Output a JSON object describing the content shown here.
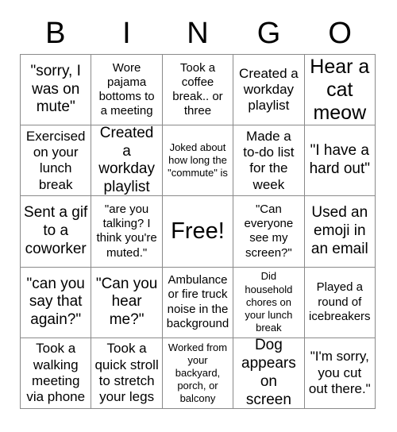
{
  "card": {
    "title": "BINGO",
    "header_letters": [
      "B",
      "I",
      "N",
      "G",
      "O"
    ],
    "rows": 5,
    "columns": 5,
    "free_space_label": "Free!",
    "free_space_position": {
      "row": 3,
      "column": 3
    },
    "colors": {
      "background": "#ffffff",
      "cell_background": "#ffffff",
      "grid_line": "#8a8a8a",
      "text": "#000000"
    }
  },
  "cells": [
    {
      "id": "r1c1",
      "text": "\"sorry, I was on mute\"",
      "size": "xl"
    },
    {
      "id": "r1c2",
      "text": "Wore pajama bottoms to a meeting",
      "size": "md"
    },
    {
      "id": "r1c3",
      "text": "Took a coffee break.. or three",
      "size": "md"
    },
    {
      "id": "r1c4",
      "text": "Created a workday playlist",
      "size": "lg"
    },
    {
      "id": "r1c5",
      "text": "Hear a cat meow",
      "size": "xxl"
    },
    {
      "id": "r2c1",
      "text": "Exercised on your lunch break",
      "size": "lg"
    },
    {
      "id": "r2c2",
      "text": "Created a workday playlist",
      "size": "xl"
    },
    {
      "id": "r2c3",
      "text": "Joked about how long the \"commute\" is",
      "size": "sm"
    },
    {
      "id": "r2c4",
      "text": "Made a to-do list for the week",
      "size": "lg"
    },
    {
      "id": "r2c5",
      "text": "\"I have a hard out\"",
      "size": "xl"
    },
    {
      "id": "r3c1",
      "text": "Sent a gif to a coworker",
      "size": "xl"
    },
    {
      "id": "r3c2",
      "text": "\"are you talking? I think you're muted.\"",
      "size": "md"
    },
    {
      "id": "r3c3",
      "text": "Free!",
      "size": "free"
    },
    {
      "id": "r3c4",
      "text": "\"Can everyone see my screen?\"",
      "size": "md"
    },
    {
      "id": "r3c5",
      "text": "Used an emoji in an email",
      "size": "xl"
    },
    {
      "id": "r4c1",
      "text": "\"can you say that again?\"",
      "size": "xl"
    },
    {
      "id": "r4c2",
      "text": "\"Can you hear me?\"",
      "size": "xl"
    },
    {
      "id": "r4c3",
      "text": "Ambulance or fire truck noise in the background",
      "size": "md"
    },
    {
      "id": "r4c4",
      "text": "Did household chores on your lunch break",
      "size": "sm"
    },
    {
      "id": "r4c5",
      "text": "Played a round of icebreakers",
      "size": "md"
    },
    {
      "id": "r5c1",
      "text": "Took a walking meeting via phone",
      "size": "lg"
    },
    {
      "id": "r5c2",
      "text": "Took a quick stroll to stretch your legs",
      "size": "lg"
    },
    {
      "id": "r5c3",
      "text": "Worked from your backyard, porch, or balcony",
      "size": "sm"
    },
    {
      "id": "r5c4",
      "text": "Dog appears on screen",
      "size": "xl"
    },
    {
      "id": "r5c5",
      "text": "\"I'm sorry, you cut out there.\"",
      "size": "lg"
    }
  ]
}
